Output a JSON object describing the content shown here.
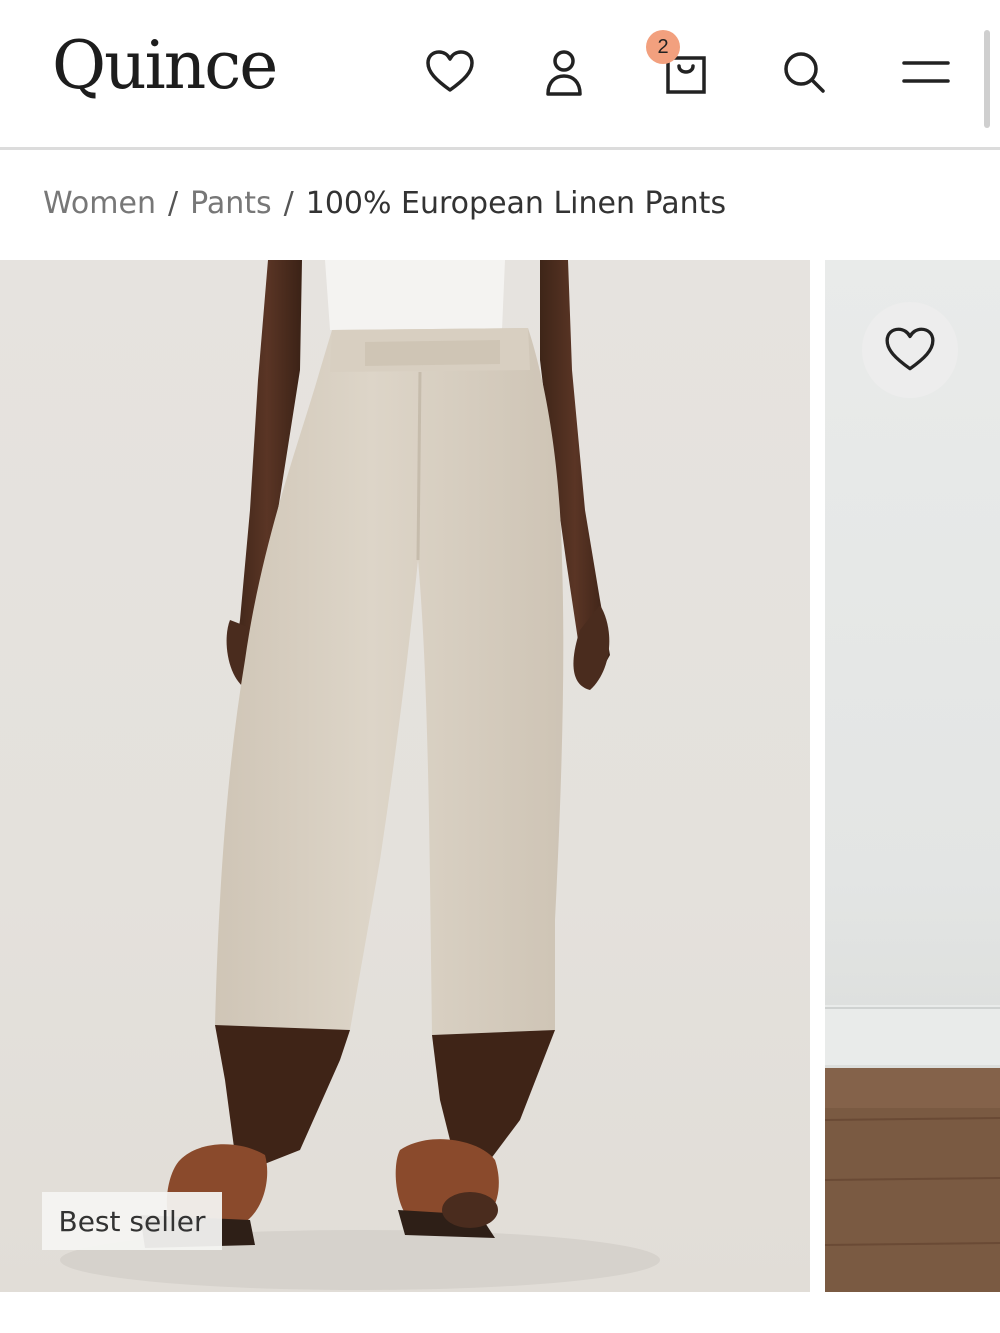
{
  "header": {
    "logo": "Quince",
    "cart_count": "2",
    "icons": [
      "heart-icon",
      "account-icon",
      "shopping-bag-icon",
      "search-icon",
      "menu-icon"
    ]
  },
  "breadcrumb": {
    "items": [
      "Women",
      "Pants"
    ],
    "separator": "/",
    "current": "100% European Linen Pants"
  },
  "gallery": {
    "badge": "Best seller",
    "favorite_icon": "heart-icon"
  },
  "colors": {
    "badge_bg": "#f2a07e",
    "pants": "#d9d0c2",
    "background": "#e4e1dc"
  }
}
